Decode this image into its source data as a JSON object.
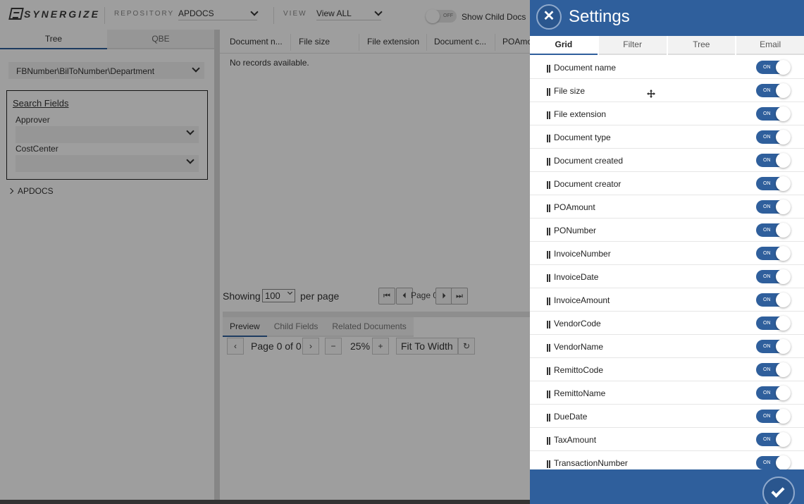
{
  "header": {
    "logo_text": "SYNERGIZE",
    "repository_label": "REPOSITORY",
    "repository_value": "APDOCS",
    "view_label": "VIEW",
    "view_value": "View ALL",
    "child_docs_toggle_state": "OFF",
    "child_docs_label": "Show Child Docs"
  },
  "left_panel": {
    "tabs": [
      "Tree",
      "QBE"
    ],
    "active_tab": "Tree",
    "path_value": "FBNumber\\BilToNumber\\Department",
    "search_fields_title": "Search Fields",
    "fields": [
      {
        "label": "Approver",
        "value": ""
      },
      {
        "label": "CostCenter",
        "value": ""
      }
    ],
    "tree_root": "APDOCS"
  },
  "grid": {
    "columns": [
      "Document n...",
      "File size",
      "File extension",
      "Document c...",
      "POAmo"
    ],
    "empty_message": "No records available.",
    "showing_label": "Showing",
    "per_page_value": "100",
    "per_page_label": "per page",
    "page_label": "Page 0"
  },
  "preview": {
    "tabs": [
      "Preview",
      "Child Fields",
      "Related Documents"
    ],
    "active_tab": "Preview",
    "page_text": "Page 0 of 0",
    "zoom": "25%",
    "fit_label": "Fit To Width"
  },
  "settings": {
    "title": "Settings",
    "tabs": [
      "Grid",
      "Filter",
      "Tree",
      "Email"
    ],
    "active_tab": "Grid",
    "on_label": "ON",
    "items": [
      {
        "label": "Document name",
        "on": true
      },
      {
        "label": "File size",
        "on": true
      },
      {
        "label": "File extension",
        "on": true
      },
      {
        "label": "Document type",
        "on": true
      },
      {
        "label": "Document created",
        "on": true
      },
      {
        "label": "Document creator",
        "on": true
      },
      {
        "label": "POAmount",
        "on": true
      },
      {
        "label": "PONumber",
        "on": true
      },
      {
        "label": "InvoiceNumber",
        "on": true
      },
      {
        "label": "InvoiceDate",
        "on": true
      },
      {
        "label": "InvoiceAmount",
        "on": true
      },
      {
        "label": "VendorCode",
        "on": true
      },
      {
        "label": "VendorName",
        "on": true
      },
      {
        "label": "RemittoCode",
        "on": true
      },
      {
        "label": "RemittoName",
        "on": true
      },
      {
        "label": "DueDate",
        "on": true
      },
      {
        "label": "TaxAmount",
        "on": true
      },
      {
        "label": "TransactionNumber",
        "on": true
      }
    ]
  },
  "colors": {
    "accent": "#2f5f9c",
    "overlay": "rgba(0,0,0,0.38)"
  }
}
